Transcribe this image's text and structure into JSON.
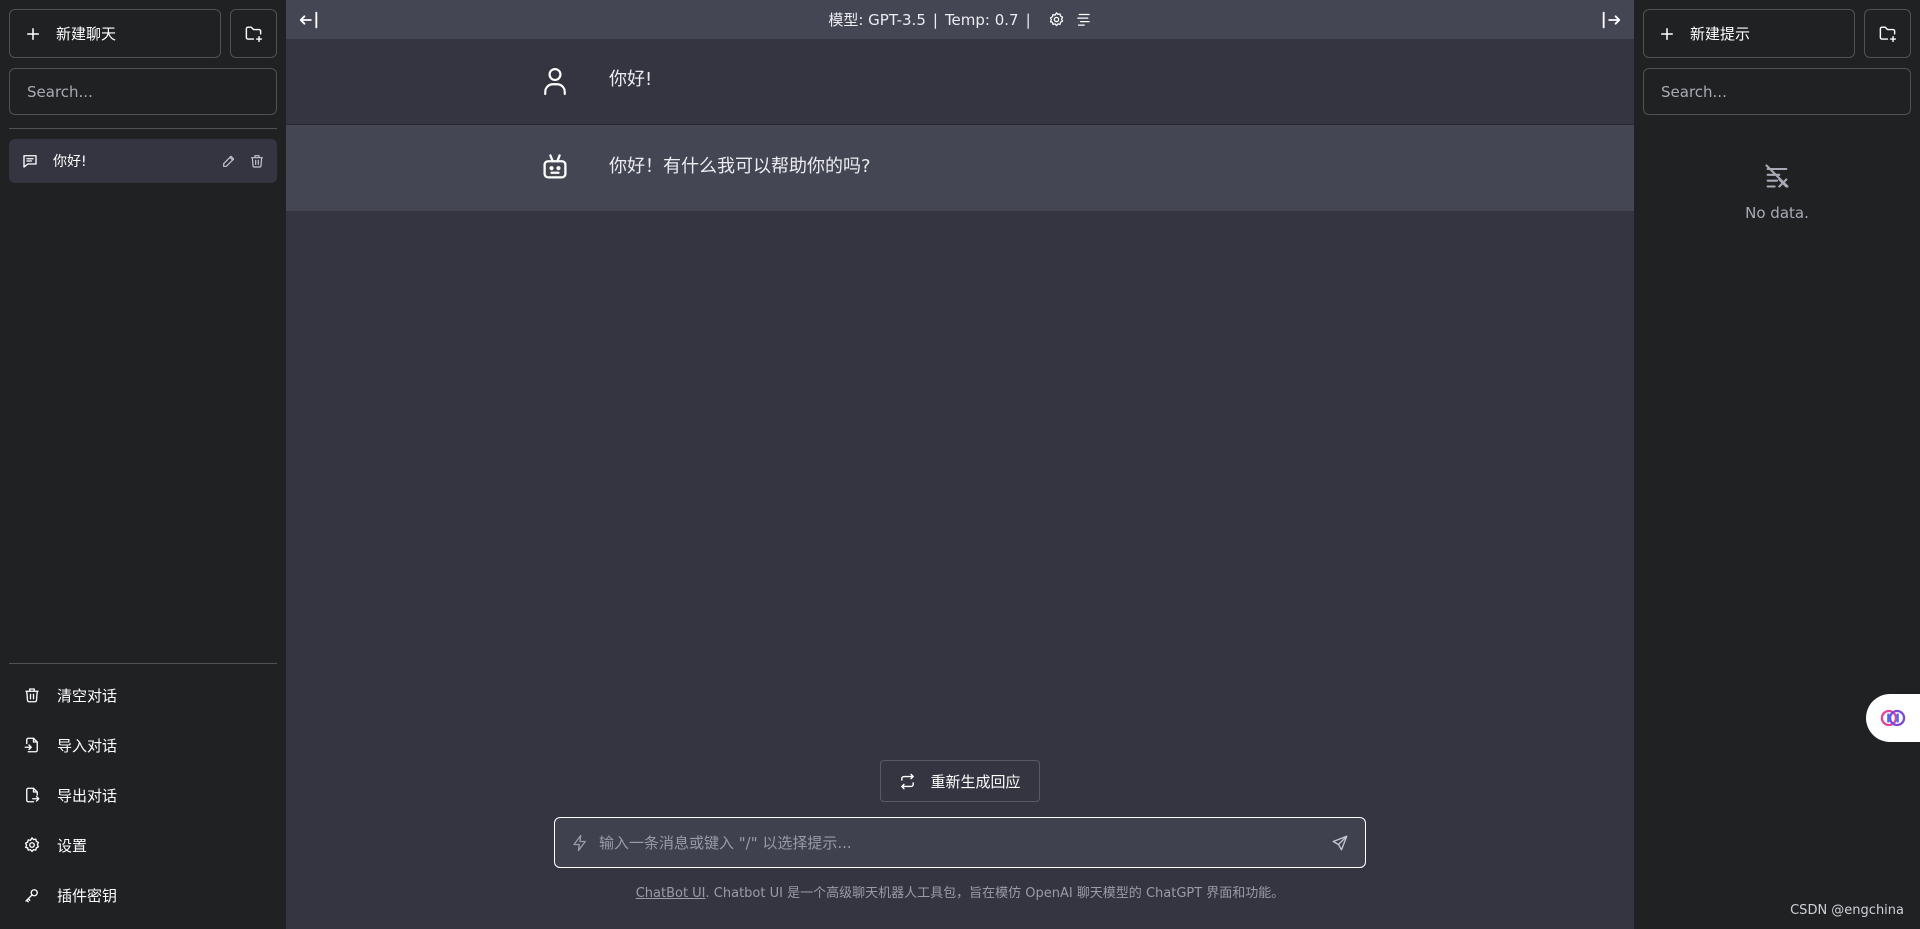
{
  "left_sidebar": {
    "new_chat_label": "新建聊天",
    "search_placeholder": "Search...",
    "conversations": [
      {
        "title": "你好!"
      }
    ],
    "menu": {
      "clear": "清空对话",
      "import": "导入对话",
      "export": "导出对话",
      "settings": "设置",
      "plugin_keys": "插件密钥"
    }
  },
  "topbar": {
    "model": "模型: GPT-3.5",
    "temp": "Temp: 0.7"
  },
  "messages": [
    {
      "role": "user",
      "text": "你好!"
    },
    {
      "role": "assistant",
      "text": "你好！有什么我可以帮助你的吗?"
    }
  ],
  "regenerate_label": "重新生成回应",
  "composer": {
    "placeholder": "输入一条消息或键入 \"/\" 以选择提示..."
  },
  "footer": {
    "link": "ChatBot UI",
    "text": ". Chatbot UI 是一个高级聊天机器人工具包，旨在模仿 OpenAI 聊天模型的 ChatGPT 界面和功能。"
  },
  "right_sidebar": {
    "new_prompt_label": "新建提示",
    "search_placeholder": "Search...",
    "empty_text": "No data."
  },
  "watermark": "CSDN @engchina"
}
